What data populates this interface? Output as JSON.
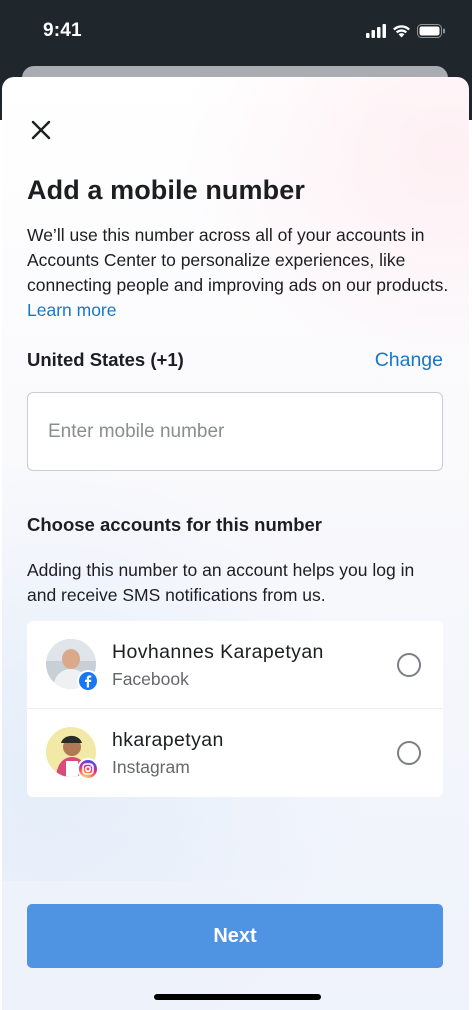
{
  "status_bar": {
    "time": "9:41"
  },
  "dialog": {
    "title": "Add a mobile number",
    "description": "We’ll use this number across all of your accounts in Accounts Center to personalize experiences, like connecting people and improving ads on our products.",
    "learn_more": "Learn more",
    "country": "United States (+1)",
    "change_label": "Change",
    "phone_input": {
      "placeholder": "Enter mobile number",
      "value": ""
    },
    "accounts_section": {
      "title": "Choose accounts for this number",
      "description": "Adding this number to an account helps you log in and receive SMS notifications from us."
    },
    "accounts": [
      {
        "name": "Hovhannes Karapetyan",
        "platform": "Facebook",
        "badge_icon": "facebook-icon",
        "selected": false
      },
      {
        "name": "hkarapetyan",
        "platform": "Instagram",
        "badge_icon": "instagram-icon",
        "selected": false
      }
    ],
    "next_label": "Next"
  },
  "colors": {
    "accent": "#1877c8",
    "button": "#4f94e3",
    "facebook": "#1877f2",
    "instagram": "#e1306c"
  }
}
